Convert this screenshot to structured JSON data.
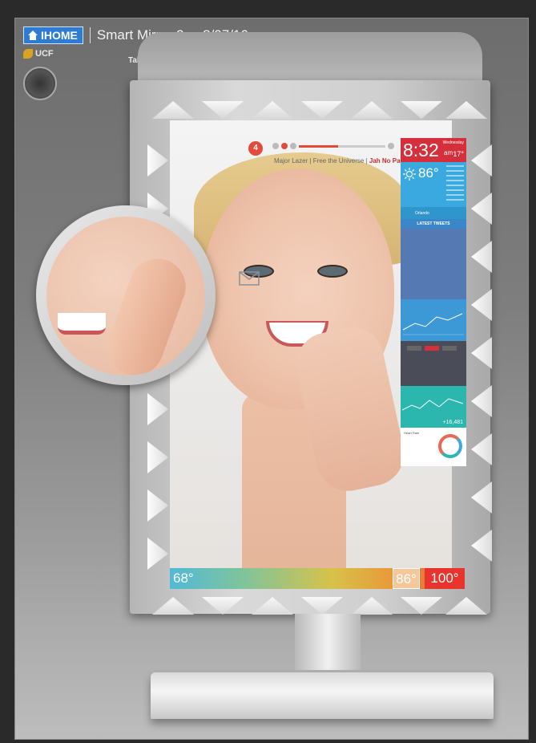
{
  "header": {
    "brand": "IHOME",
    "title": "Smart Mirror 2x - 8/07/16"
  },
  "ucf": {
    "logo_text": "UCF"
  },
  "annotation": {
    "tablet_label": "Tablet"
  },
  "mirror": {
    "notifications": {
      "count": "4"
    },
    "music": {
      "artist": "Major Lazer | Free the Universe | ",
      "track": "Jah No Partial"
    },
    "clock": {
      "time": "8:32",
      "ampm": "am",
      "date": "Wednesday",
      "outside_temp": "17°"
    },
    "weather": {
      "temp": "86°",
      "location": "Orlando"
    },
    "tweets": {
      "header": "LATEST TWEETS"
    },
    "steps": {
      "value": "+16,481"
    },
    "heart_rate": {
      "label": "Heart Rate"
    },
    "temperature_bar": {
      "low": "68°",
      "current": "86°",
      "high": "100°"
    }
  },
  "colors": {
    "clock_red": "#d62f3c",
    "weather_blue": "#3aa9e0",
    "steps_teal": "#2bb7ad",
    "brand_blue": "#2e7bd6"
  }
}
